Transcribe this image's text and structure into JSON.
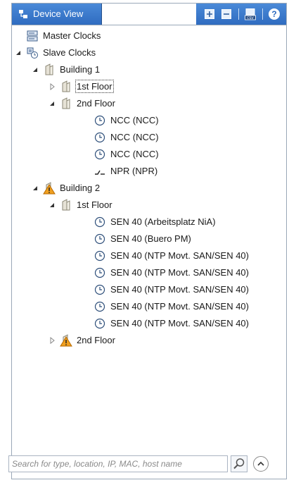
{
  "panel": {
    "title": "Device View",
    "toolbar": [
      {
        "name": "expand-all",
        "icon": "expand-all-icon"
      },
      {
        "name": "collapse-all",
        "icon": "collapse-all-icon"
      },
      {
        "name": "export-csv",
        "icon": "csv-export-icon",
        "text": "CSV"
      },
      {
        "name": "help",
        "icon": "help-icon"
      }
    ]
  },
  "tree": {
    "nodes": [
      {
        "label": "Master Clocks",
        "icon": "master-clock-icon"
      },
      {
        "label": "Slave Clocks",
        "icon": "slave-clock-icon",
        "expanded": true
      },
      {
        "label": "Building 1",
        "icon": "building-icon",
        "expanded": true
      },
      {
        "label": "1st Floor",
        "icon": "floor-icon",
        "expanded": false,
        "focused": true
      },
      {
        "label": "2nd Floor",
        "icon": "floor-icon",
        "expanded": true
      },
      {
        "label": "NCC (NCC)",
        "icon": "clock-icon"
      },
      {
        "label": "NCC (NCC)",
        "icon": "clock-icon"
      },
      {
        "label": "NCC (NCC)",
        "icon": "clock-icon"
      },
      {
        "label": "NPR (NPR)",
        "icon": "npr-device-icon"
      },
      {
        "label": "Building 2",
        "icon": "building-warning-icon",
        "expanded": true,
        "warning": true
      },
      {
        "label": "1st Floor",
        "icon": "floor-icon",
        "expanded": true
      },
      {
        "label": "SEN 40 (Arbeitsplatz NiA)",
        "icon": "clock-icon"
      },
      {
        "label": "SEN 40 (Buero PM)",
        "icon": "clock-icon"
      },
      {
        "label": "SEN 40 (NTP Movt. SAN/SEN 40)",
        "icon": "clock-icon"
      },
      {
        "label": "SEN 40 (NTP Movt. SAN/SEN 40)",
        "icon": "clock-icon"
      },
      {
        "label": "SEN 40 (NTP Movt. SAN/SEN 40)",
        "icon": "clock-icon"
      },
      {
        "label": "SEN 40 (NTP Movt. SAN/SEN 40)",
        "icon": "clock-icon"
      },
      {
        "label": "SEN 40 (NTP Movt. SAN/SEN 40)",
        "icon": "clock-icon"
      },
      {
        "label": "2nd Floor",
        "icon": "floor-warning-icon",
        "expanded": false,
        "warning": true
      }
    ]
  },
  "search": {
    "placeholder": "Search for type, location, IP, MAC, host name",
    "value": ""
  },
  "colors": {
    "header_blue": "#3a78cc",
    "border": "#9aa8b8",
    "warning": "#f0a020"
  }
}
